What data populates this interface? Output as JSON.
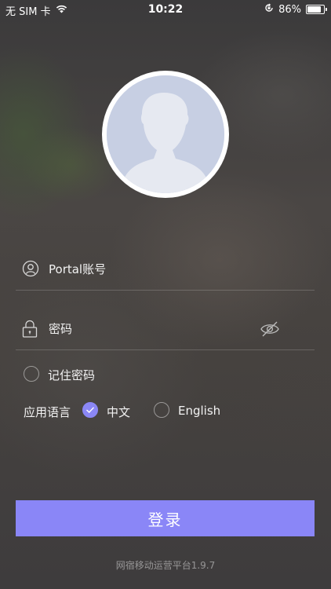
{
  "status_bar": {
    "carrier": "无 SIM 卡",
    "time": "10:22",
    "battery_text": "86%",
    "battery_level": 0.86,
    "icons": [
      "wifi-icon",
      "orientation-lock-icon",
      "battery-icon"
    ]
  },
  "avatar": {
    "icon": "default-user-silhouette"
  },
  "form": {
    "account_placeholder": "Portal账号",
    "password_placeholder": "密码",
    "remember_label": "记住密码",
    "remember_checked": false,
    "account_icon": "user-icon",
    "password_icon": "lock-icon",
    "password_toggle_icon": "eye-off-icon"
  },
  "language": {
    "title": "应用语言",
    "options": [
      {
        "label": "中文",
        "selected": true
      },
      {
        "label": "English",
        "selected": false
      }
    ]
  },
  "login_button": "登录",
  "version": "网宿移动运营平台1.9.7",
  "colors": {
    "accent": "#8a86f7"
  }
}
